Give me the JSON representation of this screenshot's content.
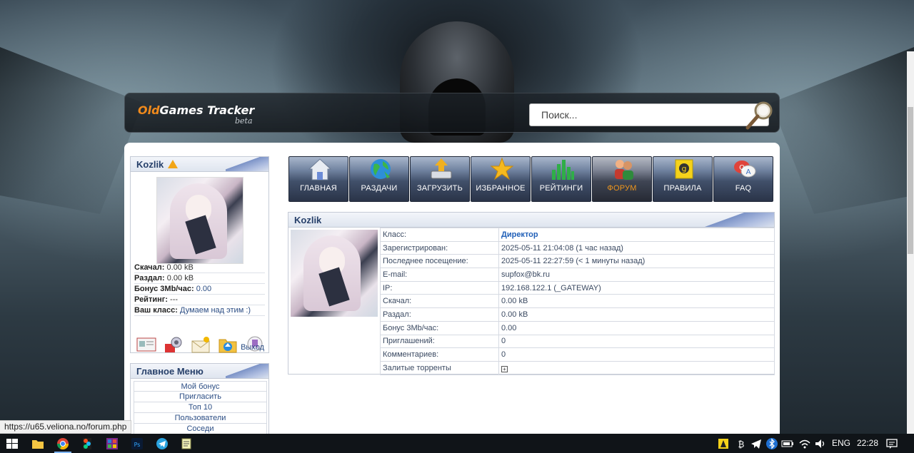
{
  "site": {
    "logo_old": "Old",
    "logo_rest": "Games Tracker",
    "logo_beta": "beta"
  },
  "search": {
    "placeholder": "Поиск..."
  },
  "user_block": {
    "username": "Kozlik",
    "stats": [
      {
        "label": "Скачал:",
        "value": "0.00 kB"
      },
      {
        "label": "Раздал:",
        "value": "0.00 kB"
      },
      {
        "label": "Бонус 3Mb/час:",
        "value": "0.00"
      },
      {
        "label": "Рейтинг:",
        "value": "---"
      },
      {
        "label": "Ваш класс:",
        "value": "Думаем над этим :)"
      }
    ],
    "quick_icons": [
      "profile-card-icon",
      "settings-icon",
      "messages-icon",
      "upload-folder-icon",
      "bookmark-icon"
    ],
    "logout": "Выход"
  },
  "main_menu": {
    "title": "Главное Меню",
    "items": [
      "Мой бонус",
      "Пригласить",
      "Топ 10",
      "Пользователи",
      "Соседи"
    ]
  },
  "nav": {
    "items": [
      {
        "label": "ГЛАВНАЯ",
        "icon": "home-icon"
      },
      {
        "label": "РАЗДАЧИ",
        "icon": "globe-icon"
      },
      {
        "label": "ЗАГРУЗИТЬ",
        "icon": "upload-icon"
      },
      {
        "label": "ИЗБРАННОЕ",
        "icon": "star-icon"
      },
      {
        "label": "РЕЙТИНГИ",
        "icon": "chart-icon"
      },
      {
        "label": "ФОРУМ",
        "icon": "people-icon"
      },
      {
        "label": "ПРАВИЛА",
        "icon": "rules-icon"
      },
      {
        "label": "FAQ",
        "icon": "faq-icon"
      }
    ],
    "active_index": 5,
    "active_color": "#f0961d"
  },
  "profile": {
    "title": "Kozlik",
    "rows": [
      {
        "key": "Класс:",
        "value": "Директор"
      },
      {
        "key": "Зарегистрирован:",
        "value": "2025-05-11 21:04:08 (1 час назад)"
      },
      {
        "key": "Последнее посещение:",
        "value": "2025-05-11 22:27:59 (< 1 минуты назад)"
      },
      {
        "key": "E-mail:",
        "value": "supfox@bk.ru"
      },
      {
        "key": "IP:",
        "value": "192.168.122.1 (_GATEWAY)"
      },
      {
        "key": "Скачал:",
        "value": "0.00 kB"
      },
      {
        "key": "Раздал:",
        "value": "0.00 kB"
      },
      {
        "key": "Бонус 3Mb/час:",
        "value": "0.00"
      },
      {
        "key": "Приглашений:",
        "value": "0"
      },
      {
        "key": "Комментариев:",
        "value": "0"
      },
      {
        "key": "Залитые торренты",
        "value": "+"
      }
    ]
  },
  "status_bar": {
    "url": "https://u65.veliona.no/forum.php"
  },
  "taskbar": {
    "apps": [
      "file-explorer-icon",
      "chrome-icon",
      "figma-icon",
      "winrar-icon",
      "photoshop-icon",
      "telegram-icon",
      "notepad-icon"
    ],
    "language": "ENG",
    "time": "22:28"
  },
  "colors": {
    "accent_orange": "#f08a1c",
    "link_blue": "#2b4d84",
    "header_blue": "#27406a"
  }
}
